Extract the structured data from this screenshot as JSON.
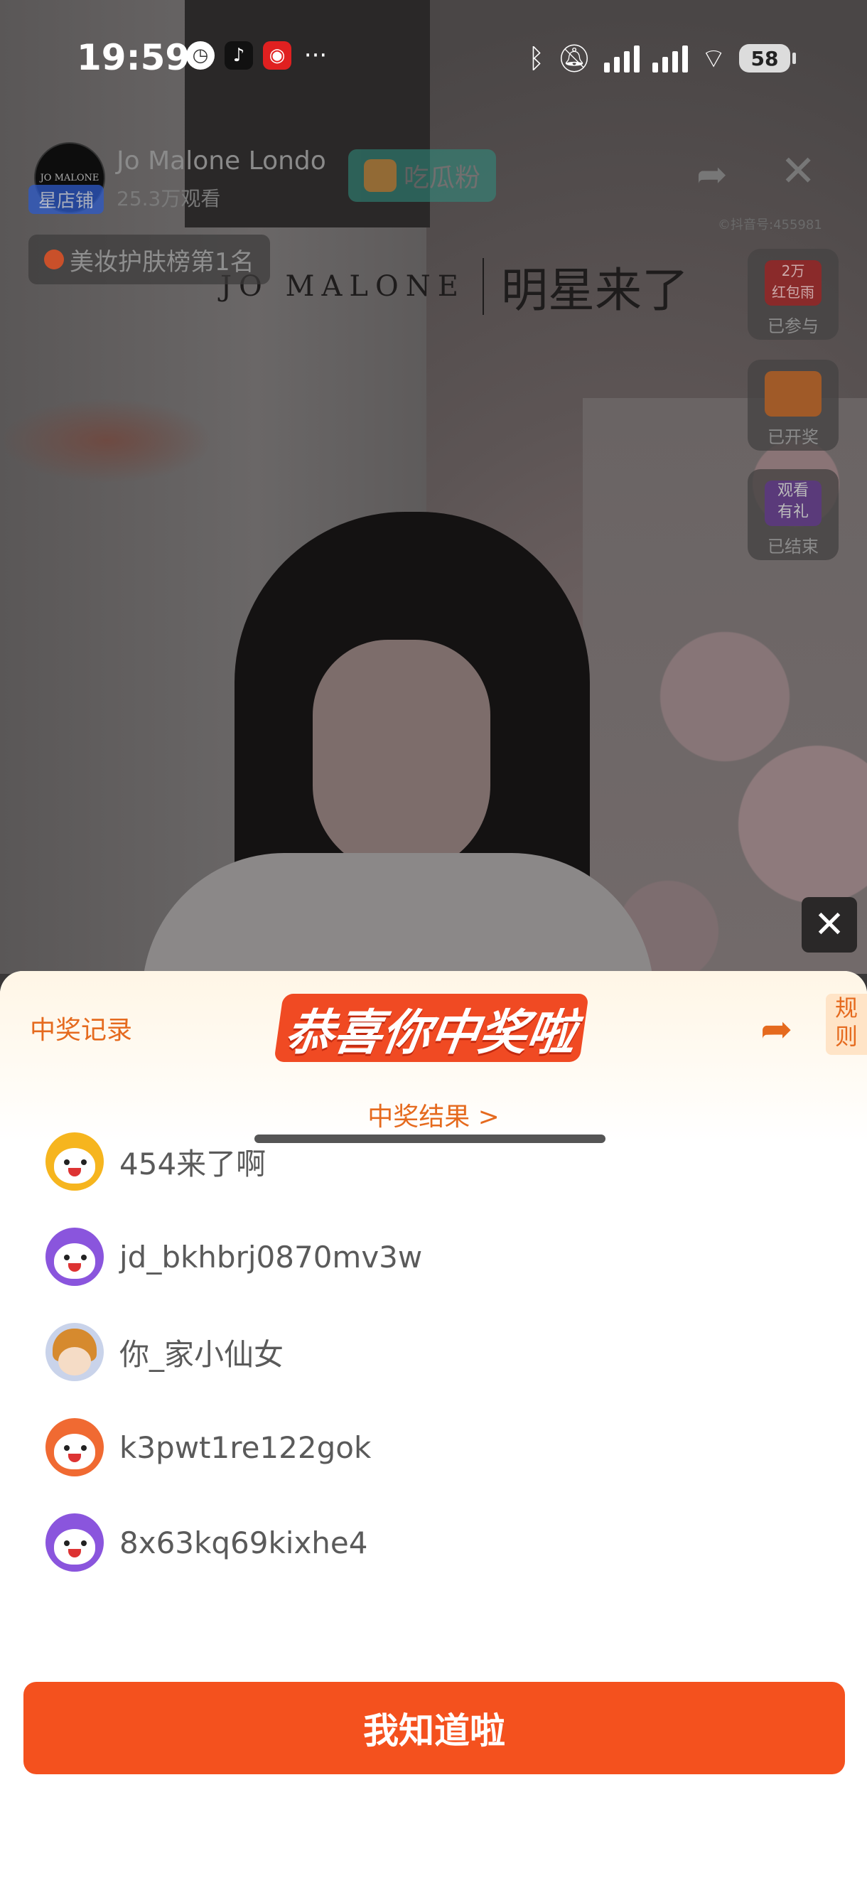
{
  "status_bar": {
    "time": "19:59",
    "battery": "58",
    "icons": [
      "clock-icon",
      "tiktok-icon",
      "app-icon",
      "more-icon",
      "bluetooth-icon",
      "mute-icon",
      "signal-icon",
      "wifi-icon",
      "battery-icon"
    ]
  },
  "stream": {
    "store_name": "Jo Malone Londo",
    "store_logo_text": "JO MALONE",
    "store_badge": "星店铺",
    "viewers": "25.3万观看",
    "follow_label": "吃瓜粉",
    "small_text": "©抖音号:455981",
    "rank": "美妆护肤榜第1名",
    "banner_brand": "JO MALONE",
    "banner_title": "明星来了",
    "widgets": [
      {
        "pic_text": "2万\n红包雨",
        "caption": "已参与"
      },
      {
        "pic_text": "",
        "caption": "已开奖"
      },
      {
        "pic_text": "观看\n有礼",
        "caption": "已结束"
      }
    ]
  },
  "sheet": {
    "records_link": "中奖记录",
    "title": "恭喜你中奖啦",
    "rules": "规则",
    "result_link": "中奖结果 >",
    "winners": [
      {
        "name": "454来了啊",
        "avatar": "yellow"
      },
      {
        "name": "jd_bkhbrj0870mv3w",
        "avatar": "purple"
      },
      {
        "name": "你_家小仙女",
        "avatar": "girl"
      },
      {
        "name": "k3pwt1re122gok",
        "avatar": "orange"
      },
      {
        "name": "8x63kq69kixhe4",
        "avatar": "purple"
      }
    ],
    "confirm_label": "我知道啦"
  },
  "colors": {
    "accent": "#f4511e",
    "link": "#e56a1e"
  }
}
